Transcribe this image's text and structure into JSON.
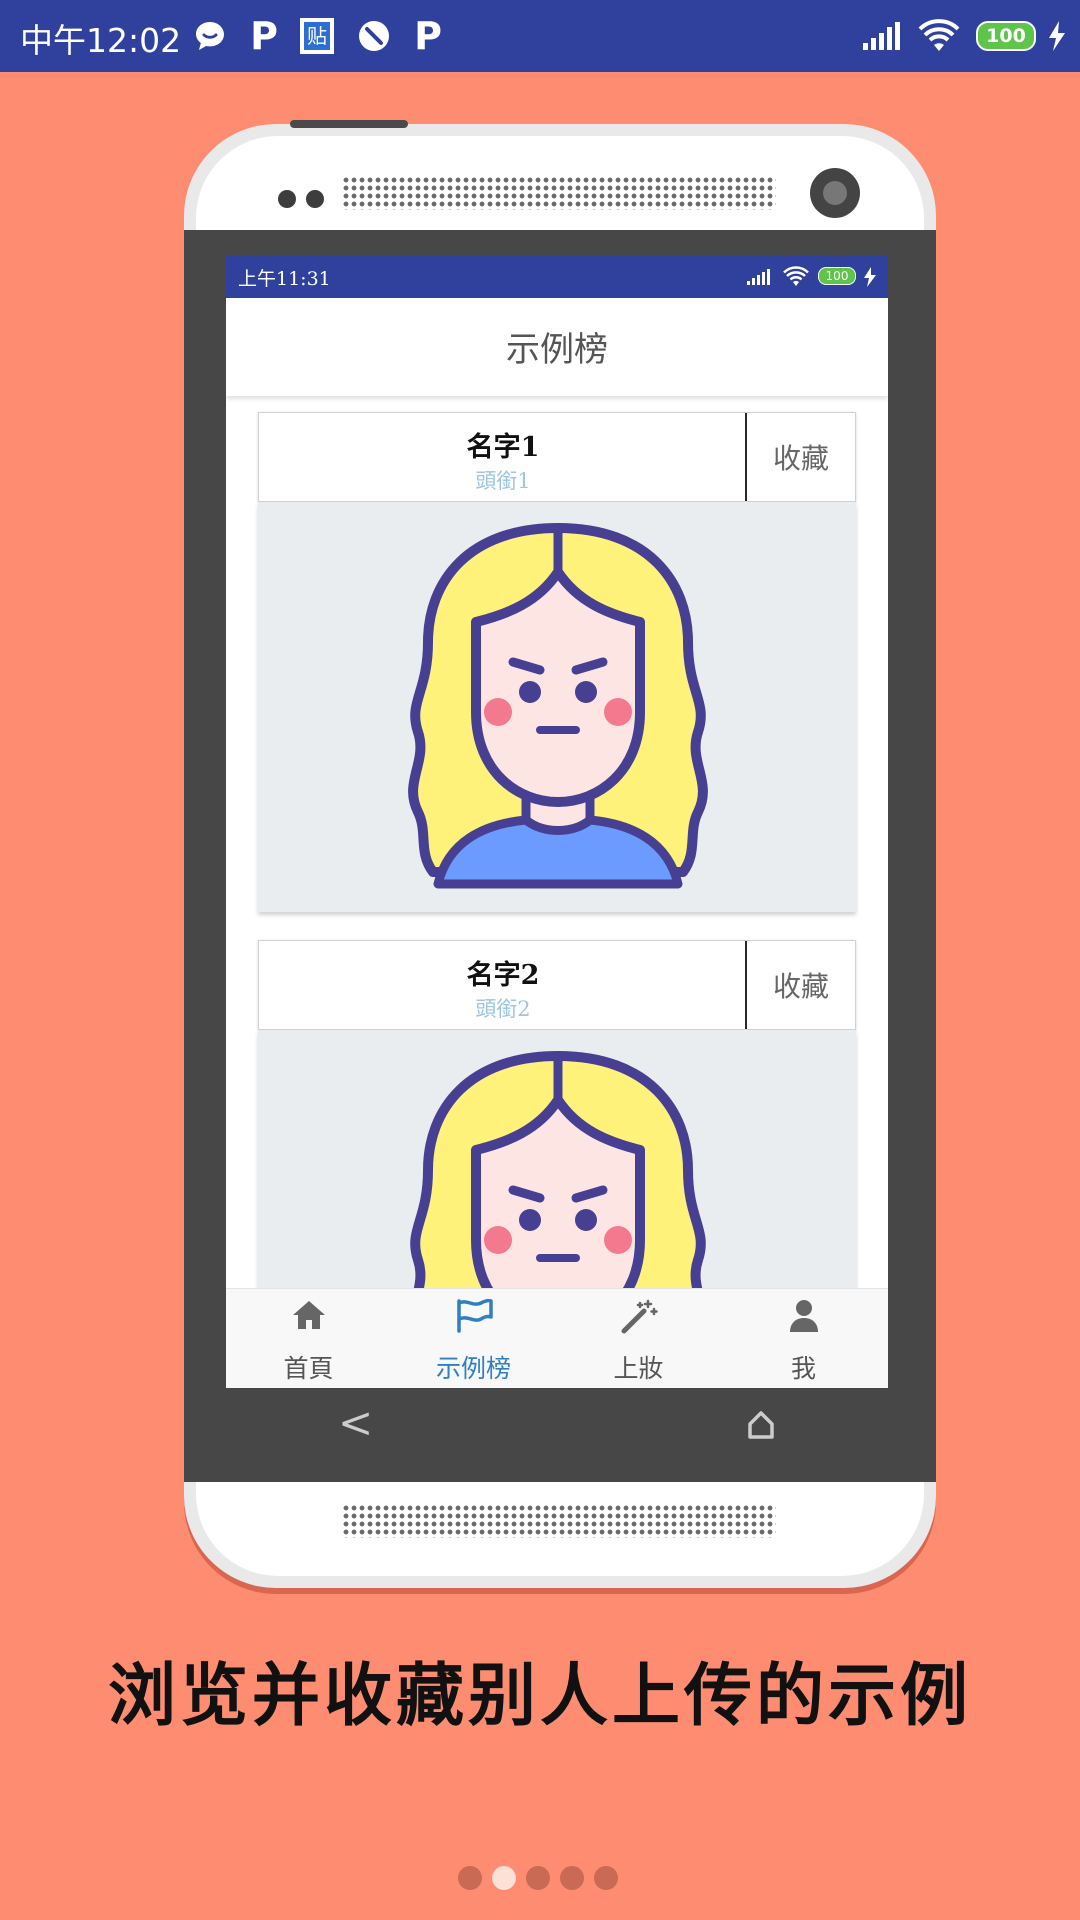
{
  "device_status": {
    "time": "中午12:02",
    "notification_icons": [
      "chat-bubble-icon",
      "p-app-icon",
      "tieba-icon",
      "blocked-icon",
      "p-app-icon"
    ],
    "p_glyph": "P",
    "tieba_glyph": "贴",
    "battery": "100"
  },
  "phone_status": {
    "time": "上午11:31",
    "battery": "100"
  },
  "header": {
    "title": "示例榜"
  },
  "cards": [
    {
      "name": "名字1",
      "subtitle": "頭銜1",
      "favorite_label": "收藏"
    },
    {
      "name": "名字2",
      "subtitle": "頭銜2",
      "favorite_label": "收藏"
    }
  ],
  "bottom_nav": [
    {
      "label": "首頁",
      "icon": "home-icon",
      "active": false
    },
    {
      "label": "示例榜",
      "icon": "flag-icon",
      "active": true
    },
    {
      "label": "上妝",
      "icon": "magic-wand-icon",
      "active": false
    },
    {
      "label": "我",
      "icon": "user-icon",
      "active": false
    }
  ],
  "soft_keys": {
    "back": "<",
    "home_icon": "home-outline-icon"
  },
  "caption": "浏览并收藏别人上传的示例",
  "pager": {
    "pages": 5,
    "current": 2
  },
  "colors": {
    "background": "#fd8c70",
    "status_bar": "#30409d",
    "active_nav": "#2f7fc1",
    "subtitle": "#9cc6e6"
  }
}
